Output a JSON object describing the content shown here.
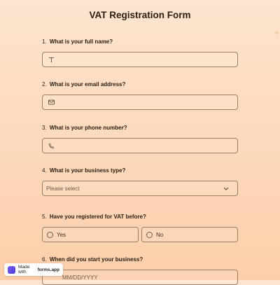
{
  "form": {
    "title": "VAT Registration Form",
    "questions": [
      {
        "number": "1.",
        "label": "What is your full name?",
        "icon": "text-icon"
      },
      {
        "number": "2.",
        "label": "What is your email address?",
        "icon": "mail-icon"
      },
      {
        "number": "3.",
        "label": "What is your phone number?",
        "icon": "phone-icon"
      },
      {
        "number": "4.",
        "label": "What is your business type?",
        "placeholder": "Please select"
      },
      {
        "number": "5.",
        "label": "Have you registered for VAT before?",
        "options": [
          "Yes",
          "No"
        ]
      },
      {
        "number": "6.",
        "label": "When did you start your business?",
        "placeholder": "MM/DD/YYYY"
      }
    ]
  },
  "badge": {
    "prefix": "Made with",
    "brand": "forms.app"
  },
  "colors": {
    "background": "#fcd6b6",
    "border": "#9b8069",
    "text": "#2b1d12"
  }
}
